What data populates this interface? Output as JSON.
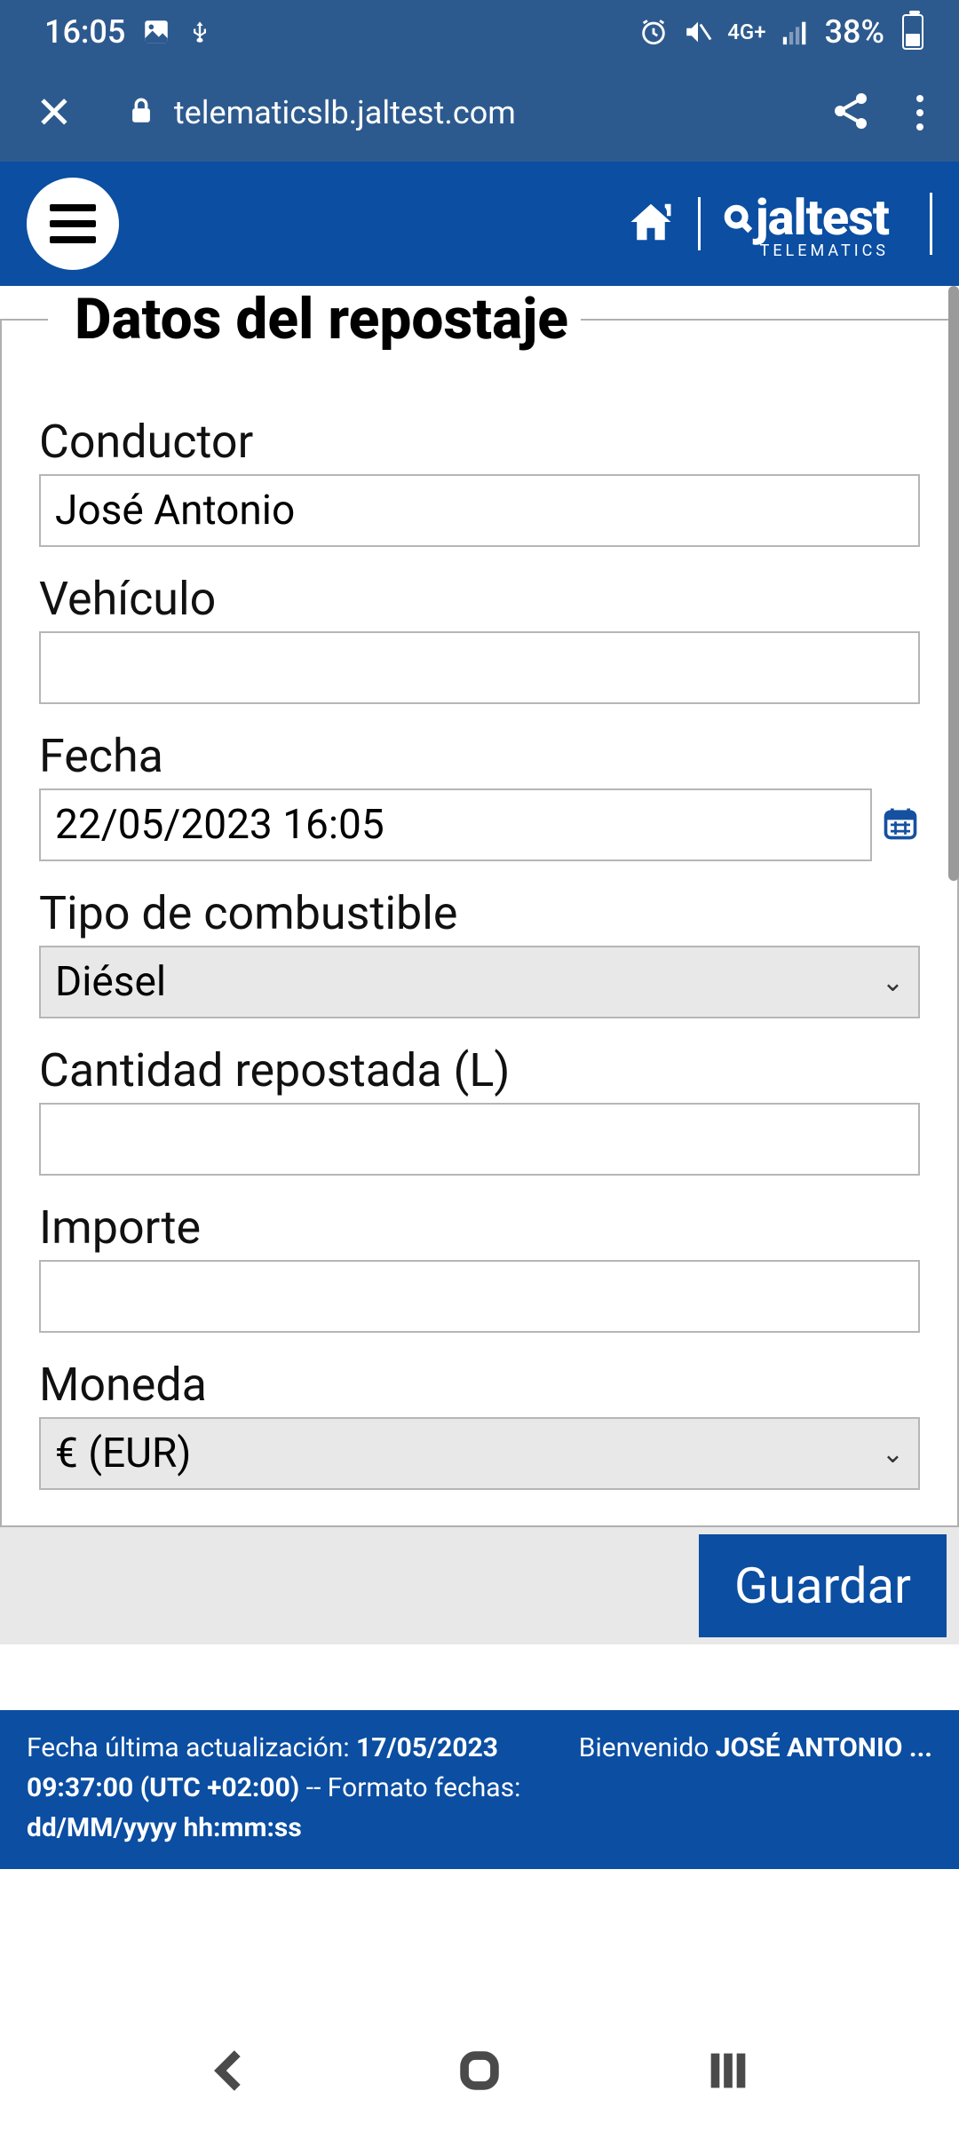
{
  "status": {
    "time": "16:05",
    "battery_pct": "38%",
    "network": "4G+"
  },
  "browser": {
    "url": "telematicslb.jaltest.com"
  },
  "brand": {
    "name": "jaltest",
    "sub": "TELEMATICS"
  },
  "form": {
    "legend": "Datos del repostaje",
    "conductor_label": "Conductor",
    "conductor_value": "José Antonio",
    "vehiculo_label": "Vehículo",
    "vehiculo_value": "",
    "fecha_label": "Fecha",
    "fecha_value": "22/05/2023 16:05",
    "tipo_label": "Tipo de combustible",
    "tipo_value": "Diésel",
    "cantidad_label": "Cantidad repostada (L)",
    "cantidad_value": "",
    "importe_label": "Importe",
    "importe_value": "",
    "moneda_label": "Moneda",
    "moneda_value": "€ (EUR)"
  },
  "actions": {
    "save": "Guardar"
  },
  "footer": {
    "update_prefix": "Fecha última actualización: ",
    "update_value": "17/05/2023 09:37:00 (UTC +02:00)",
    "format_prefix": " -- Formato fechas: ",
    "format_value": "dd/MM/yyyy hh:mm:ss",
    "welcome_prefix": "Bienvenido ",
    "welcome_user": "JOSÉ ANTONIO ..."
  }
}
